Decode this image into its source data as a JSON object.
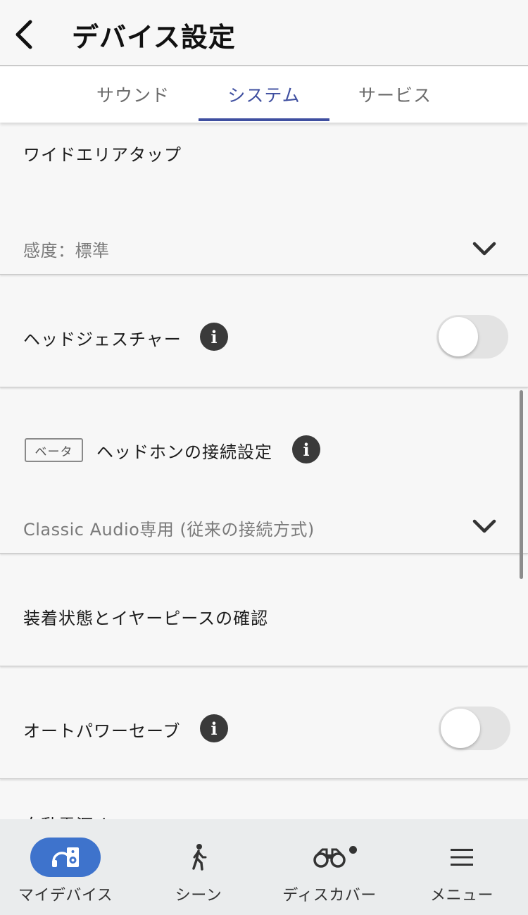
{
  "header": {
    "title": "デバイス設定"
  },
  "tabs": [
    {
      "label": "サウンド",
      "active": false
    },
    {
      "label": "システム",
      "active": true
    },
    {
      "label": "サービス",
      "active": false
    }
  ],
  "settings": {
    "wide_area_tap": {
      "title": "ワイドエリアタップ",
      "value": "感度：標準"
    },
    "head_gesture": {
      "title": "ヘッドジェスチャー",
      "enabled": false
    },
    "connection": {
      "badge": "ベータ",
      "title": "ヘッドホンの接続設定",
      "value": "Classic Audio専用 (従来の接続方式)"
    },
    "fit_check": {
      "title": "装着状態とイヤーピースの確認"
    },
    "auto_power_save": {
      "title": "オートパワーセーブ",
      "enabled": false
    },
    "auto_power_off": {
      "title": "自動電源オフ"
    }
  },
  "bottom_nav": [
    {
      "label": "マイデバイス",
      "icon": "my-device-icon",
      "active": true
    },
    {
      "label": "シーン",
      "icon": "walking-person-icon",
      "active": false
    },
    {
      "label": "ディスカバー",
      "icon": "binoculars-icon",
      "active": false,
      "badge_dot": true
    },
    {
      "label": "メニュー",
      "icon": "hamburger-menu-icon",
      "active": false
    }
  ],
  "colors": {
    "accent": "#3f4fa0",
    "active_nav_pill": "#3e73cc",
    "info_icon": "#3a3a3a",
    "toggle_off": "#e3e3e3"
  }
}
